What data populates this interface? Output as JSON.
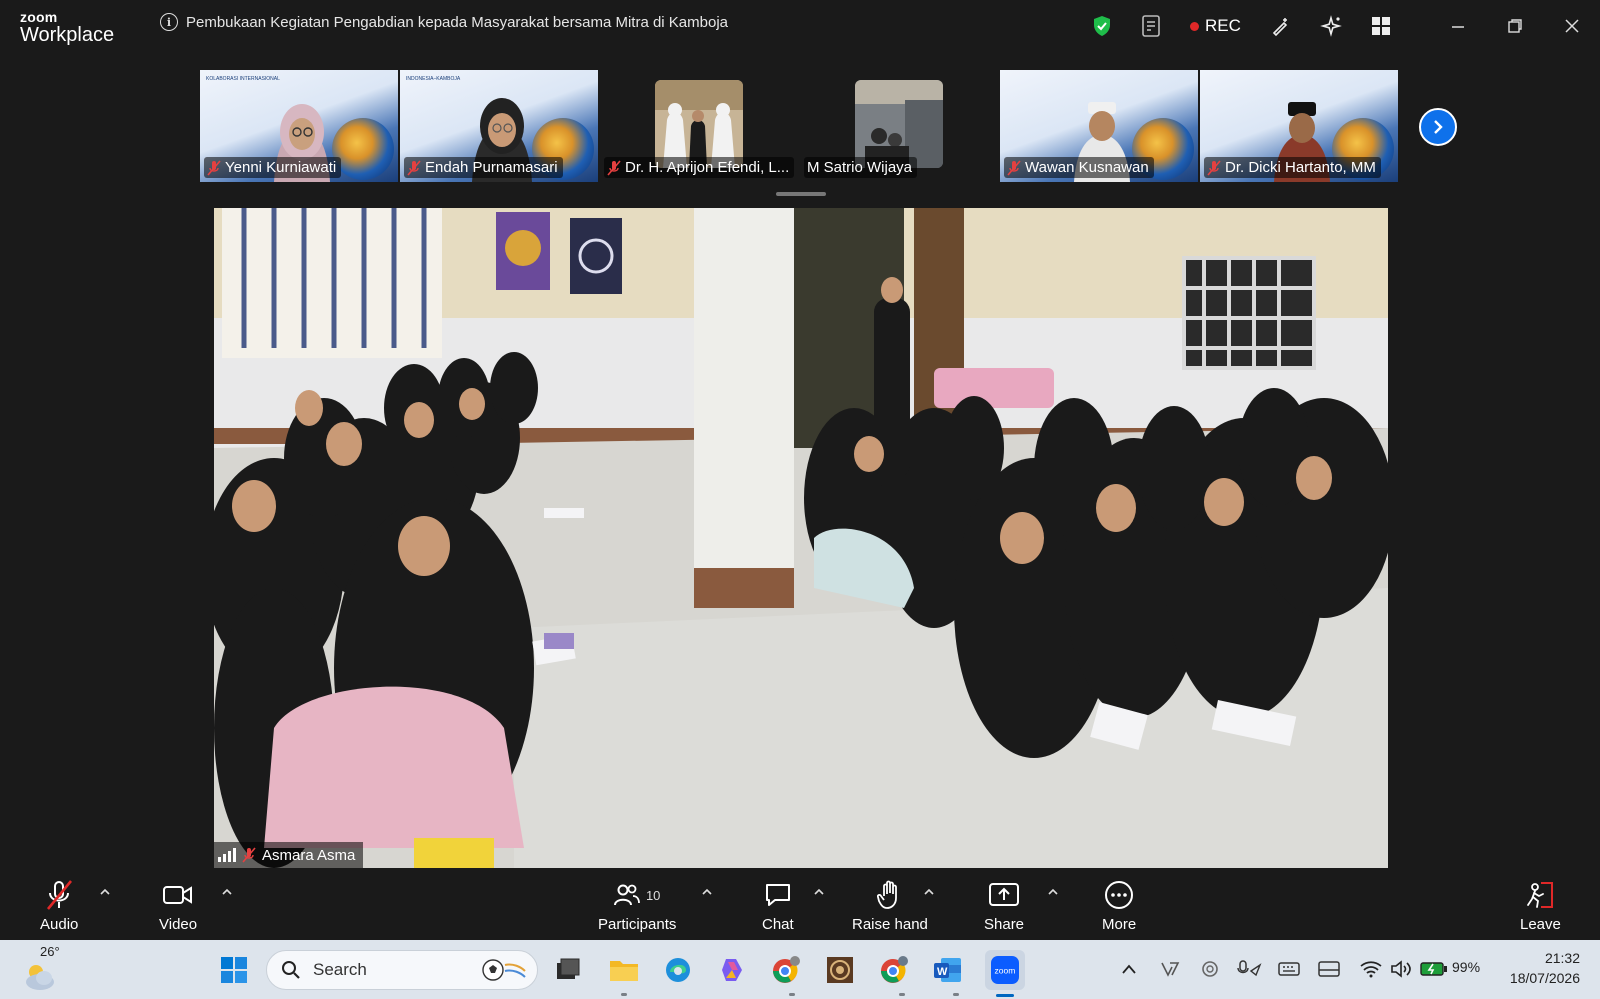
{
  "app": {
    "logo_line1": "zoom",
    "logo_line2": "Workplace"
  },
  "meeting": {
    "title": "Pembukaan Kegiatan Pengabdian kepada Masyarakat bersama Mitra di Kamboja"
  },
  "titlebar": {
    "rec_label": "REC",
    "shield_color": "#1fbd4a",
    "rec_color": "#e02828"
  },
  "participants_strip": [
    {
      "name": "Yenni Kurniawati",
      "muted": true
    },
    {
      "name": "Endah Purnamasari",
      "muted": true
    },
    {
      "name": "Dr. H. Aprijon Efendi, L...",
      "muted": true
    },
    {
      "name": "M Satrio Wijaya",
      "muted": false
    },
    {
      "name": "Wawan Kusnawan",
      "muted": true
    },
    {
      "name": "Dr. Dicki Hartanto, MM",
      "muted": true
    }
  ],
  "slide_text": {
    "line1": "KOLABORASI INTERNASIONAL",
    "line2": "INDONESIA–KAMBOJA"
  },
  "active_speaker": {
    "name": "Asmara Asma",
    "muted": true
  },
  "controls": {
    "audio": "Audio",
    "video": "Video",
    "participants": "Participants",
    "participants_count": "10",
    "chat": "Chat",
    "raise_hand": "Raise hand",
    "share": "Share",
    "more": "More",
    "leave": "Leave"
  },
  "taskbar": {
    "weather_temp": "26°",
    "search_placeholder": "Search",
    "battery": "99%",
    "time": "21:32",
    "date": "18/07/2026",
    "accent": "#0067c0"
  }
}
